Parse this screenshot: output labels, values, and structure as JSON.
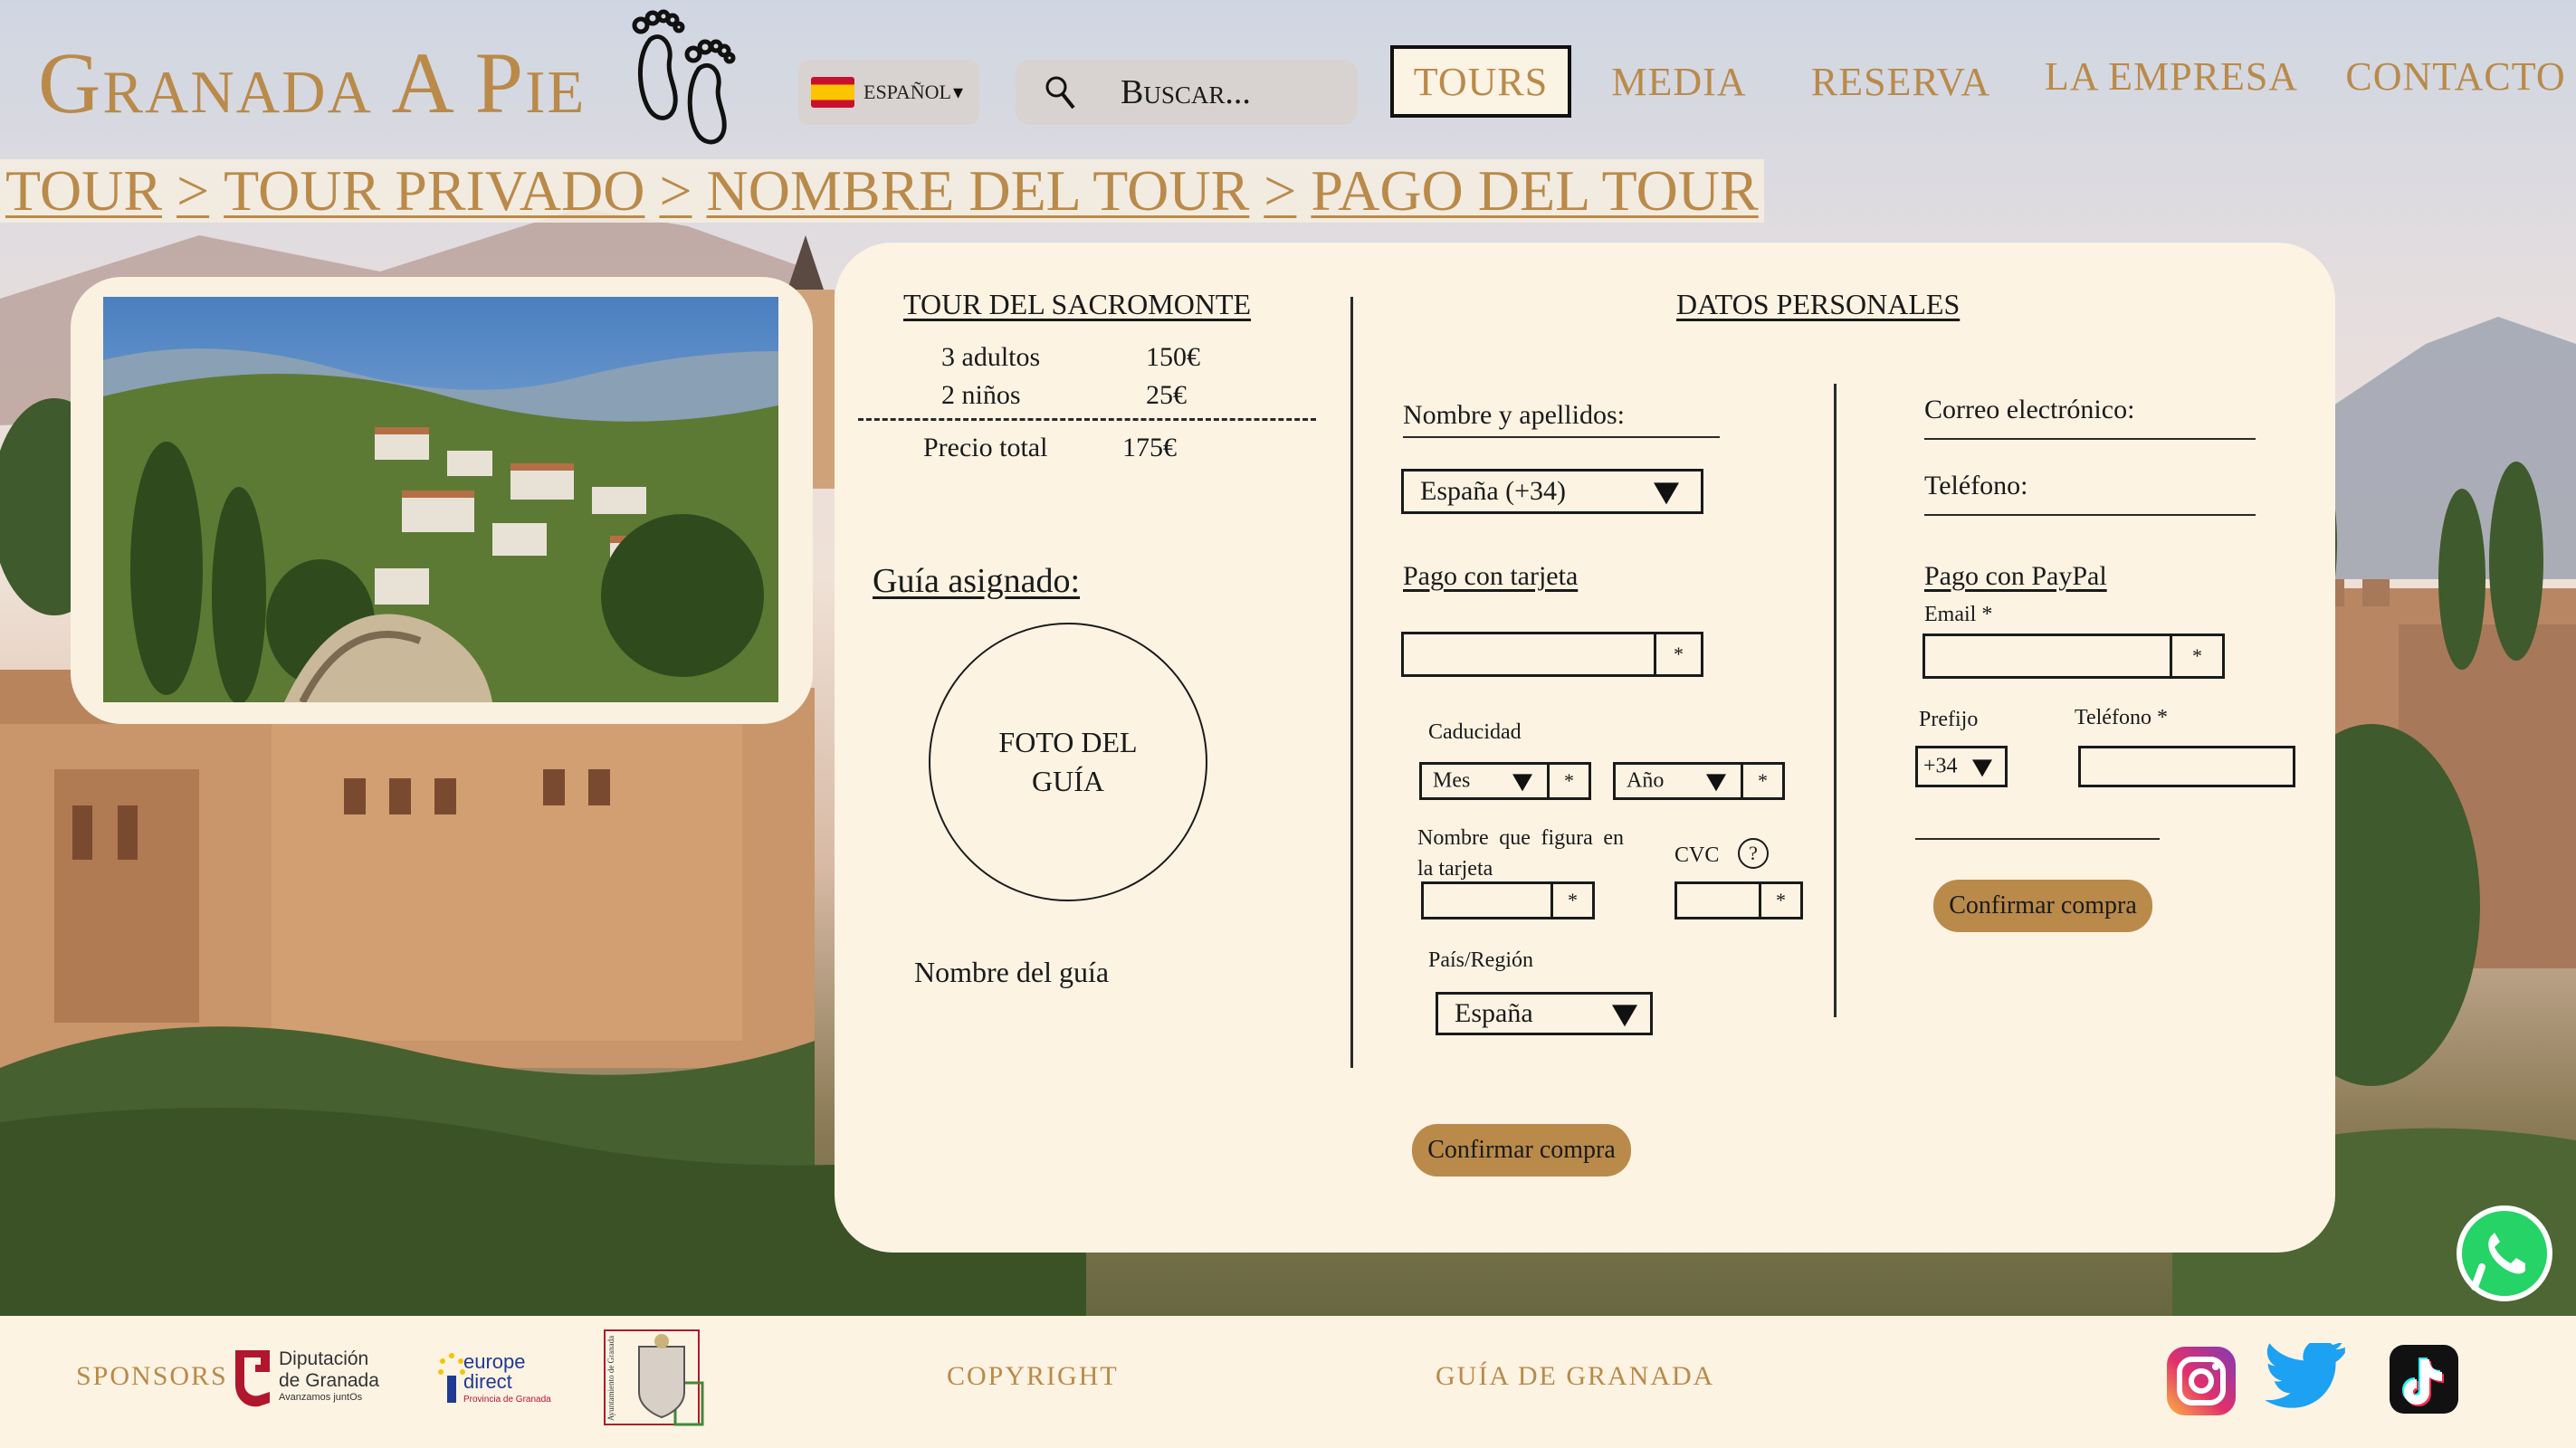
{
  "header": {
    "brand": "Granada A Pie",
    "language": {
      "label": "ESPAÑOL",
      "caret": "▾"
    },
    "search": {
      "placeholder": "Buscar..."
    },
    "nav": [
      {
        "label": "TOURS",
        "active": true
      },
      {
        "label": "MEDIA",
        "active": false
      },
      {
        "label": "RESERVA",
        "active": false
      },
      {
        "label": "LA EMPRESA",
        "active": false
      },
      {
        "label": "CONTACTO",
        "active": false
      }
    ]
  },
  "breadcrumb": [
    "TOUR",
    "TOUR PRIVADO",
    "NOMBRE DEL TOUR",
    "PAGO DEL TOUR"
  ],
  "breadcrumb_separator": ">",
  "summary": {
    "tour_name": "TOUR DEL SACROMONTE",
    "lines": [
      {
        "label": "3 adultos",
        "price": "150€"
      },
      {
        "label": "2 niños",
        "price": "25€"
      }
    ],
    "total_label": "Precio total",
    "total_value": "175€",
    "guide_heading": "Guía asignado:",
    "guide_photo_line1": "FOTO DEL",
    "guide_photo_line2": "GUÍA",
    "guide_name": "Nombre del guía"
  },
  "form": {
    "heading": "DATOS PERSONALES",
    "name_label": "Nombre y apellidos:",
    "country_code_value": "España (+34)",
    "card_heading": "Pago con tarjeta",
    "required_mark": "*",
    "expiry_label": "Caducidad",
    "month_value": "Mes",
    "year_value": "Año",
    "cardholder_label": "Nombre que figura en la tarjeta",
    "cvc_label": "CVC",
    "help_mark": "?",
    "country_label": "País/Región",
    "country_value": "España",
    "confirm_label": "Confirmar compra",
    "email_label": "Correo electrónico:",
    "phone_label": "Teléfono:",
    "paypal_heading": "Pago con PayPal",
    "paypal_email_label": "Email *",
    "prefix_label": "Prefijo",
    "prefix_value": "+34",
    "paypal_phone_label": "Teléfono *",
    "paypal_confirm_label": "Confirmar compra"
  },
  "footer": {
    "sponsors_label": "SPONSORS",
    "sponsor1_line1": "Diputación",
    "sponsor1_line2": "de Granada",
    "sponsor1_tagline": "Avanzamos juntOs",
    "sponsor2_line1": "europe",
    "sponsor2_line2": "direct",
    "sponsor2_line3": "Provincia de Granada",
    "sponsor3_text": "Ayuntamiento de Granada",
    "copyright_label": "COPYRIGHT",
    "guide_label": "GUÍA DE GRANADA",
    "social": [
      "instagram",
      "twitter",
      "tiktok"
    ]
  },
  "colors": {
    "accent": "#b98a4a",
    "panel": "#fdf3e3",
    "active_nav_border": "#111111"
  }
}
